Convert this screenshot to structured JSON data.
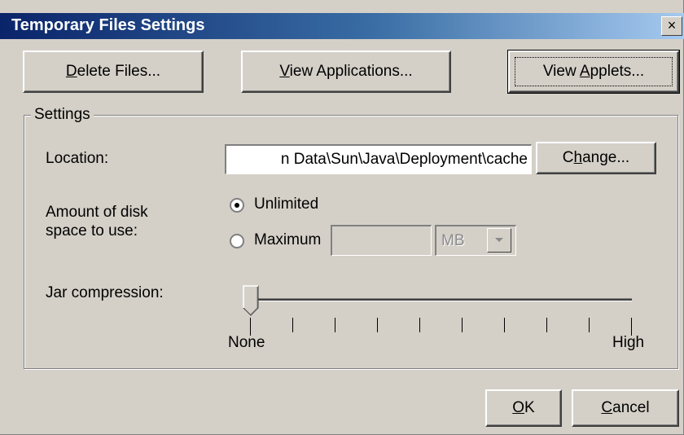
{
  "window": {
    "title": "Temporary Files Settings",
    "close_glyph": "×"
  },
  "buttons": {
    "delete": {
      "mnemonic": "D",
      "rest": "elete Files..."
    },
    "view_apps": {
      "mnemonic": "V",
      "rest": "iew Applications..."
    },
    "view_applets": {
      "pre": "View ",
      "mnemonic": "A",
      "rest": "pplets..."
    },
    "change": {
      "pre": "C",
      "mnemonic": "h",
      "rest": "ange..."
    },
    "ok": {
      "mnemonic": "O",
      "rest": "K"
    },
    "cancel": {
      "mnemonic": "C",
      "rest": "ancel"
    }
  },
  "settings": {
    "legend": "Settings",
    "location_label": "Location:",
    "location_value": "n Data\\Sun\\Java\\Deployment\\cache",
    "disk_label_line1": "Amount of disk",
    "disk_label_line2": "space to use:",
    "unlimited_label": "Unlimited",
    "maximum_label": "Maximum",
    "maximum_value": "",
    "unit": "MB",
    "selected_option": "Unlimited",
    "jar_label": "Jar compression:",
    "slider_min_label": "None",
    "slider_max_label": "High",
    "slider_position_fraction": 0
  },
  "icons": {
    "dropdown": "chevron-down-icon",
    "close": "close-icon"
  }
}
